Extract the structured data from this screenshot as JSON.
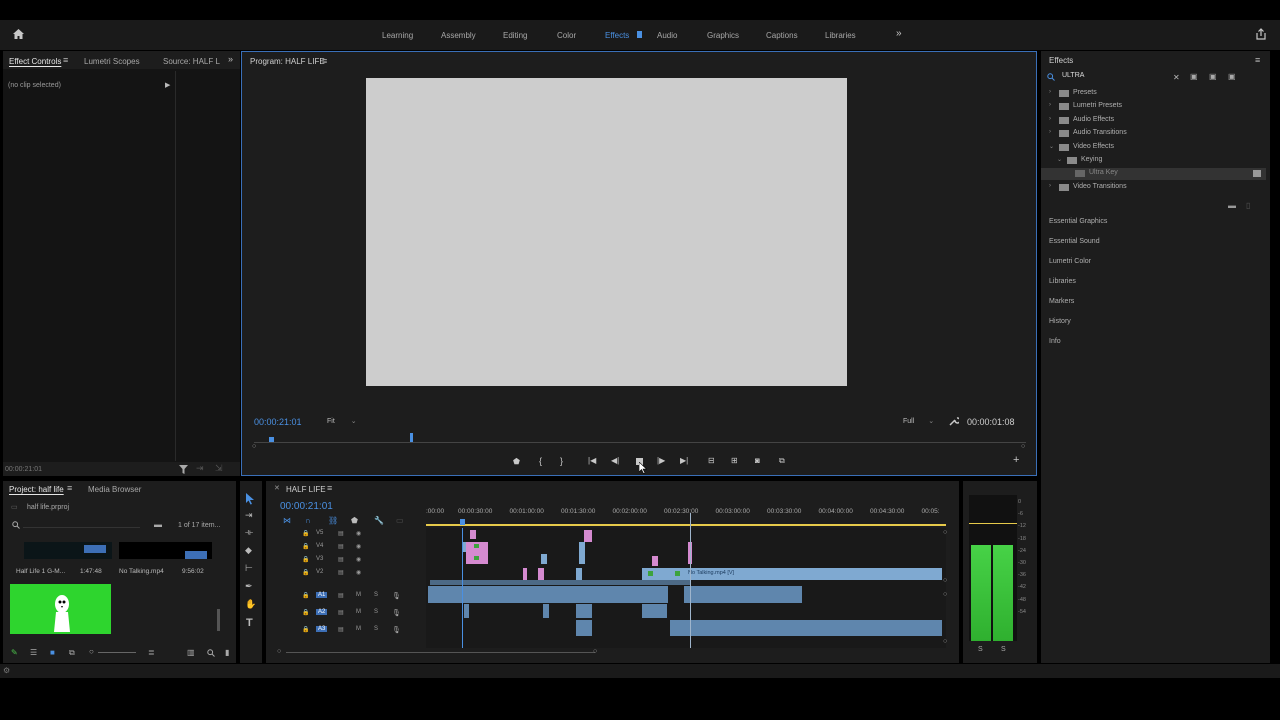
{
  "workspaces": {
    "items": [
      "Learning",
      "Assembly",
      "Editing",
      "Color",
      "Effects",
      "Audio",
      "Graphics",
      "Captions",
      "Libraries"
    ],
    "active": "Effects"
  },
  "left_top_panel": {
    "tabs": [
      "Effect Controls",
      "Lumetri Scopes",
      "Source: HALF L"
    ],
    "no_clip": "(no clip selected)",
    "timecode": "00:00:21:01"
  },
  "program_monitor": {
    "tab": "Program: HALF LIFE",
    "timecode": "00:00:21:01",
    "fit": "Fit",
    "quality": "Full",
    "duration": "00:00:01:08"
  },
  "effects_panel": {
    "title": "Effects",
    "search_value": "ULTRA",
    "tree": [
      {
        "label": "Presets",
        "level": 0
      },
      {
        "label": "Lumetri Presets",
        "level": 0
      },
      {
        "label": "Audio Effects",
        "level": 0
      },
      {
        "label": "Audio Transitions",
        "level": 0
      },
      {
        "label": "Video Effects",
        "level": 0
      },
      {
        "label": "Keying",
        "level": 1
      },
      {
        "label": "Ultra Key",
        "level": 2
      },
      {
        "label": "Video Transitions",
        "level": 0
      }
    ],
    "sections": [
      "Essential Graphics",
      "Essential Sound",
      "Lumetri Color",
      "Libraries",
      "Markers",
      "History",
      "Info"
    ]
  },
  "project_panel": {
    "tabs": [
      "Project: half life",
      "Media Browser"
    ],
    "file": "half life.prproj",
    "count": "1 of 17 item...",
    "items": [
      {
        "name": "Half Life 1 G-M...",
        "duration": "1:47:48"
      },
      {
        "name": "No Talking.mp4",
        "duration": "9:56:02"
      }
    ]
  },
  "timeline": {
    "tab": "HALF LIFE",
    "timecode": "00:00:21:01",
    "ruler": [
      ":00:00",
      "00:00:30:00",
      "00:01:00:00",
      "00:01:30:00",
      "00:02:00:00",
      "00:02:30:00",
      "00:03:00:00",
      "00:03:30:00",
      "00:04:00:00",
      "00:04:30:00",
      "00:05:"
    ],
    "video_tracks": [
      "V5",
      "V4",
      "V3",
      "V2"
    ],
    "audio_tracks": [
      "A1",
      "A2",
      "A3"
    ],
    "clip_label": "No Talking.mp4 [V]"
  },
  "meter": {
    "scale": [
      "0",
      "-6",
      "-12",
      "-18",
      "-24",
      "-30",
      "-36",
      "-42",
      "-48",
      "-54"
    ],
    "solo_left": "S",
    "solo_right": "S",
    "level_fraction": 0.65
  },
  "colors": {
    "accent": "#4a90e2",
    "panel": "#1d1d1d",
    "video_clip": "#d58ad0",
    "audio_clip": "#7fa9d1"
  }
}
